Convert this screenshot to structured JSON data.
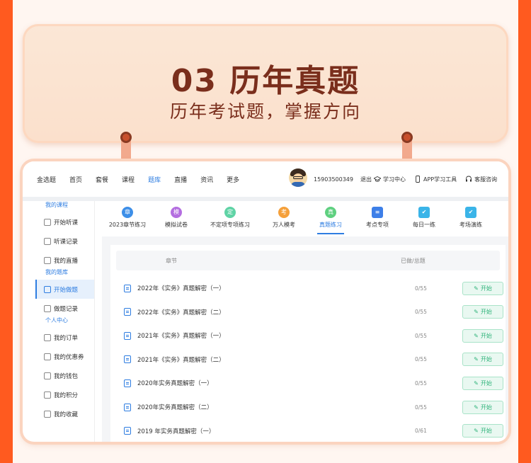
{
  "banner": {
    "title": "03 历年真题",
    "subtitle": "历年考试题，掌握方向"
  },
  "topnav": {
    "links": [
      "金选题",
      "首页",
      "套餐",
      "课程",
      "题库",
      "直播",
      "资讯",
      "更多"
    ],
    "active_index": 4,
    "phone": "15903500349",
    "logout": "退出",
    "study_center": "学习中心",
    "app_tool": "APP学习工具",
    "support": "客服咨询"
  },
  "sidebar": {
    "sections": [
      {
        "title": "我的课程",
        "items": [
          "开始听课",
          "听课记录",
          "我的直播"
        ]
      },
      {
        "title": "我的题库",
        "items": [
          "开始做题",
          "做题记录"
        ]
      },
      {
        "title": "个人中心",
        "items": [
          "我的订单",
          "我的优惠券",
          "我的钱包",
          "我的积分",
          "我的收藏"
        ]
      }
    ],
    "active_item": "开始做题"
  },
  "tabs": [
    {
      "icon_text": "章",
      "label": "2023章节练习",
      "color": "#3d8fe8"
    },
    {
      "icon_text": "模",
      "label": "模拟试卷",
      "color": "#b46ee0"
    },
    {
      "icon_text": "定",
      "label": "不定项专项练习",
      "color": "#5fd3a5"
    },
    {
      "icon_text": "考",
      "label": "万人模考",
      "color": "#f5a03a"
    },
    {
      "icon_text": "真",
      "label": "真题练习",
      "color": "#5fd080"
    },
    {
      "icon_text": "≡",
      "label": "考点专项",
      "color": "#3d7fe8"
    },
    {
      "icon_text": "✔",
      "label": "每日一练",
      "color": "#3ab4e8"
    },
    {
      "icon_text": "✔",
      "label": "考场演练",
      "color": "#3ab4e8"
    }
  ],
  "active_tab": 4,
  "table": {
    "col_chapter": "章节",
    "col_ratio": "已做/总题",
    "start_label": "开始",
    "rows": [
      {
        "title": "2022年《实务》真题解密（一）",
        "ratio": "0/55"
      },
      {
        "title": "2022年《实务》真题解密（二）",
        "ratio": "0/55"
      },
      {
        "title": "2021年《实务》真题解密（一）",
        "ratio": "0/55"
      },
      {
        "title": "2021年《实务》真题解密（二）",
        "ratio": "0/55"
      },
      {
        "title": "2020年实务真题解密（一）",
        "ratio": "0/55"
      },
      {
        "title": "2020年实务真题解密（二）",
        "ratio": "0/55"
      },
      {
        "title": "2019 年实务真题解密（一）",
        "ratio": "0/61"
      }
    ]
  }
}
